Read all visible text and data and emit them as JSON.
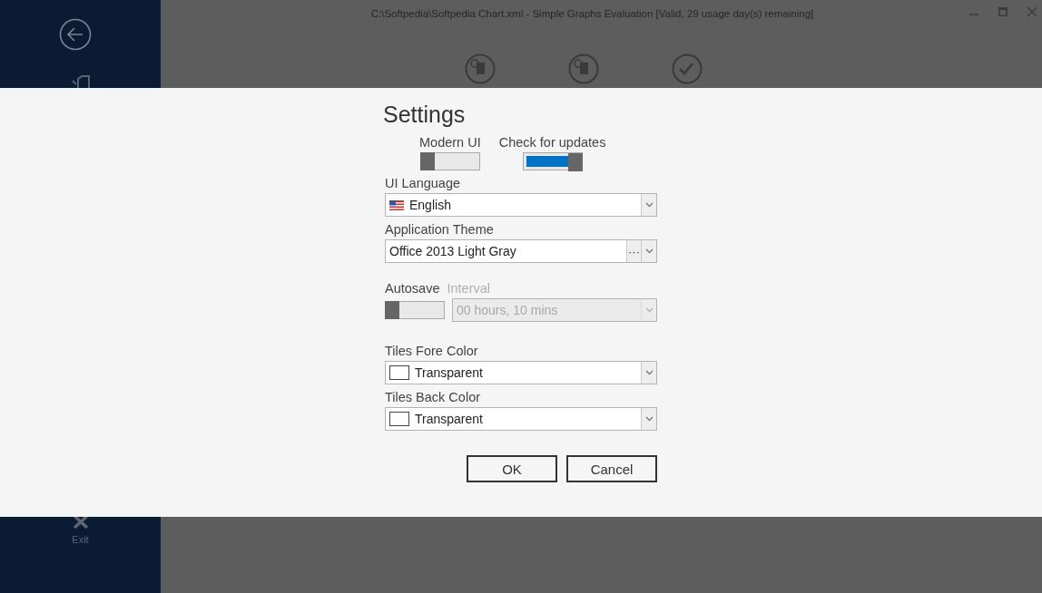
{
  "window": {
    "title": "C:\\Softpedia\\Softpedia Chart.xml - Simple Graphs Evaluation [Valid, 29 usage day(s) remaining]"
  },
  "sidebar": {
    "items": [
      {
        "label": "Exit"
      }
    ]
  },
  "settings": {
    "title": "Settings",
    "toggles": [
      {
        "label": "Modern UI",
        "on": false
      },
      {
        "label": "Check for updates",
        "on": true
      }
    ],
    "fields": [
      {
        "kind": "flag",
        "label": "UI Language",
        "value": "English"
      },
      {
        "kind": "more",
        "label": "Application Theme",
        "value": "Office 2013 Light Gray",
        "more": "···"
      }
    ],
    "autosave": {
      "label": "Autosave",
      "on": false,
      "interval": {
        "label": "Interval",
        "value": "00 hours, 10 mins",
        "disabled": true
      }
    },
    "colors": [
      {
        "label": "Tiles Fore Color",
        "value": "Transparent"
      },
      {
        "label": "Tiles Back Color",
        "value": "Transparent"
      }
    ],
    "buttons": [
      "OK",
      "Cancel"
    ]
  }
}
